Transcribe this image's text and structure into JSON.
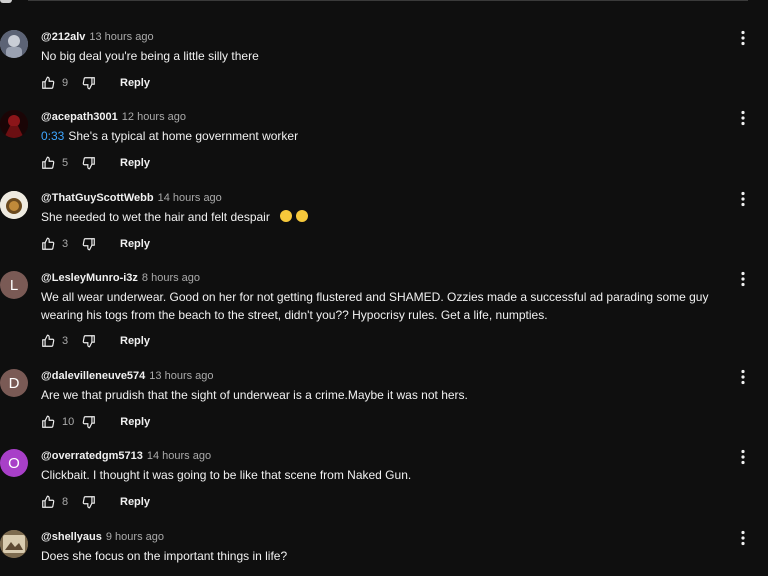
{
  "comments": [
    {
      "handle": "@212alv",
      "time": "13 hours ago",
      "text": "No big deal you're being a little silly there",
      "likes": "9",
      "reply": "Reply",
      "avatar": {
        "type": "image",
        "bg": "#8a93a8"
      }
    },
    {
      "handle": "@acepath3001",
      "time": "12 hours ago",
      "timestamp_link": "0:33",
      "text": "She's a typical at home government worker",
      "likes": "5",
      "reply": "Reply",
      "avatar": {
        "type": "image",
        "bg": "#6b0f12"
      }
    },
    {
      "handle": "@ThatGuyScottWebb",
      "time": "14 hours ago",
      "text": "She needed to wet the hair and felt despair",
      "emoji": [
        "grinning-face-emoji",
        "grinning-face-emoji"
      ],
      "likes": "3",
      "reply": "Reply",
      "avatar": {
        "type": "image",
        "bg": "#e9e5d6"
      }
    },
    {
      "handle": "@LesleyMunro-i3z",
      "time": "8 hours ago",
      "text": "We all wear underwear. Good on her for not getting flustered and SHAMED. Ozzies made a successful ad parading some guy wearing his togs from the beach to the street, didn't you?? Hypocrisy rules. Get a life, numpties.",
      "likes": "3",
      "reply": "Reply",
      "avatar": {
        "type": "letter",
        "letter": "L",
        "bg": "#7a5a55"
      }
    },
    {
      "handle": "@dalevilleneuve574",
      "time": "13 hours ago",
      "text": "Are we that prudish that the sight of underwear is a crime.Maybe it was not hers.",
      "likes": "10",
      "reply": "Reply",
      "avatar": {
        "type": "letter",
        "letter": "D",
        "bg": "#7a5a55"
      }
    },
    {
      "handle": "@overratedgm5713",
      "time": "14 hours ago",
      "text": "Clickbait. I thought it was going to be like that scene from Naked Gun.",
      "likes": "8",
      "reply": "Reply",
      "avatar": {
        "type": "letter",
        "letter": "O",
        "bg": "#a83fc8"
      }
    },
    {
      "handle": "@shellyaus",
      "time": "9 hours ago",
      "text": "Does she focus on the important things in life?",
      "likes": "",
      "reply": "",
      "avatar": {
        "type": "image",
        "bg": "#8c7a5c"
      }
    }
  ],
  "icons": {
    "like": "thumb-up-icon",
    "dislike": "thumb-down-icon",
    "more": "more-vert-icon"
  }
}
